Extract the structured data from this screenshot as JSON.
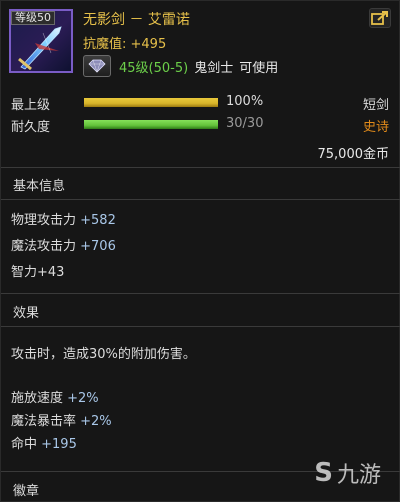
{
  "item": {
    "level_badge": "等级50",
    "name": "无影剑 － 艾雷诺",
    "resist": "抗魔值: +495",
    "requirement": {
      "level": "45级(50-5)",
      "class": "鬼剑士",
      "usable": "可使用"
    }
  },
  "bars": {
    "grade": {
      "label": "最上级",
      "value": "100%",
      "fraction": 1.0,
      "color": "#d8b52a"
    },
    "durability": {
      "label": "耐久度",
      "value": "30/30",
      "fraction": 1.0,
      "color": "#63c23a"
    }
  },
  "tags": {
    "weapon_type": "短剑",
    "rarity": "史诗",
    "rarity_color": "#e08a1a",
    "price": "75,000金币"
  },
  "sections": {
    "basic_title": "基本信息",
    "basic_stats": [
      {
        "name": "物理攻击力",
        "value": "+582"
      },
      {
        "name": "魔法攻击力",
        "value": "+706"
      },
      {
        "name": "智力",
        "value": "+43"
      }
    ],
    "effect_title": "效果",
    "effect_desc": "攻击时，造成30%的附加伤害。",
    "effect_stats": [
      {
        "name": "施放速度",
        "value": "+2%"
      },
      {
        "name": "魔法暴击率",
        "value": "+2%"
      },
      {
        "name": "命中",
        "value": "+195"
      }
    ],
    "emblem_title": "徽章"
  },
  "icons": {
    "item": "sword-icon",
    "share": "share-icon",
    "gem": "gem-icon"
  },
  "watermark": {
    "glyph": "S",
    "text": "九游"
  }
}
